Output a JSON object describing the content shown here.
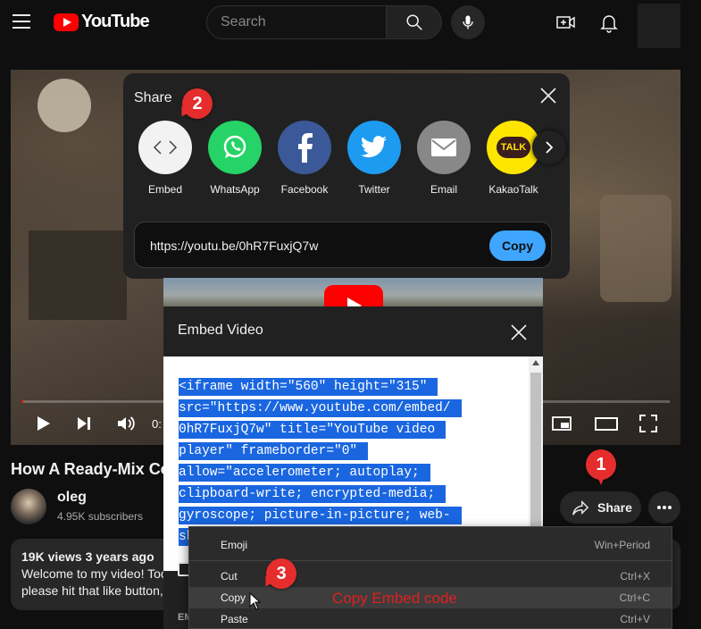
{
  "header": {
    "logo_text": "YouTube",
    "search_placeholder": "Search"
  },
  "player": {
    "time_partial": "0:"
  },
  "video": {
    "title": "How A Ready-Mix Co",
    "channel_name": "oleg",
    "subscribers": "4.95K subscribers",
    "share_label": "Share",
    "views_meta": "19K views  3 years ago",
    "description_lines": [
      "Welcome to my video! Too",
      "please hit that like button,"
    ]
  },
  "share_dialog": {
    "title": "Share",
    "options": [
      {
        "label": "Embed",
        "icon": "embed-icon",
        "color": "#f2f2f2"
      },
      {
        "label": "WhatsApp",
        "icon": "whatsapp-icon",
        "color": "#25d366"
      },
      {
        "label": "Facebook",
        "icon": "facebook-icon",
        "color": "#3b5998"
      },
      {
        "label": "Twitter",
        "icon": "twitter-icon",
        "color": "#1d9bf0"
      },
      {
        "label": "Email",
        "icon": "email-icon",
        "color": "#888888"
      },
      {
        "label": "KakaoTalk",
        "icon": "kakaotalk-icon",
        "color": "#fee500"
      }
    ],
    "kakao_badge": "TALK",
    "link": "https://youtu.be/0hR7FuxjQ7w",
    "copy_label": "Copy"
  },
  "embed_dialog": {
    "title": "Embed Video",
    "code_lines": [
      "<iframe width=\"560\" height=\"315\"",
      "src=\"https://www.youtube.com/embed/",
      "0hR7FuxjQ7w\" title=\"YouTube video",
      "player\" frameborder=\"0\"",
      "allow=\"accelerometer; autoplay;",
      "clipboard-write; encrypted-media;",
      "gyroscope; picture-in-picture; web-",
      "sh"
    ],
    "footer_partial": "EM"
  },
  "context_menu": {
    "items": [
      {
        "label": "Emoji",
        "shortcut": "Win+Period"
      },
      {
        "label": "Cut",
        "shortcut": "Ctrl+X"
      },
      {
        "label": "Copy",
        "shortcut": "Ctrl+C"
      },
      {
        "label": "Paste",
        "shortcut": "Ctrl+V"
      }
    ]
  },
  "annotations": {
    "step1": "1",
    "step2": "2",
    "step3": "3",
    "note": "Copy Embed code",
    "color": "#e52d2d"
  }
}
